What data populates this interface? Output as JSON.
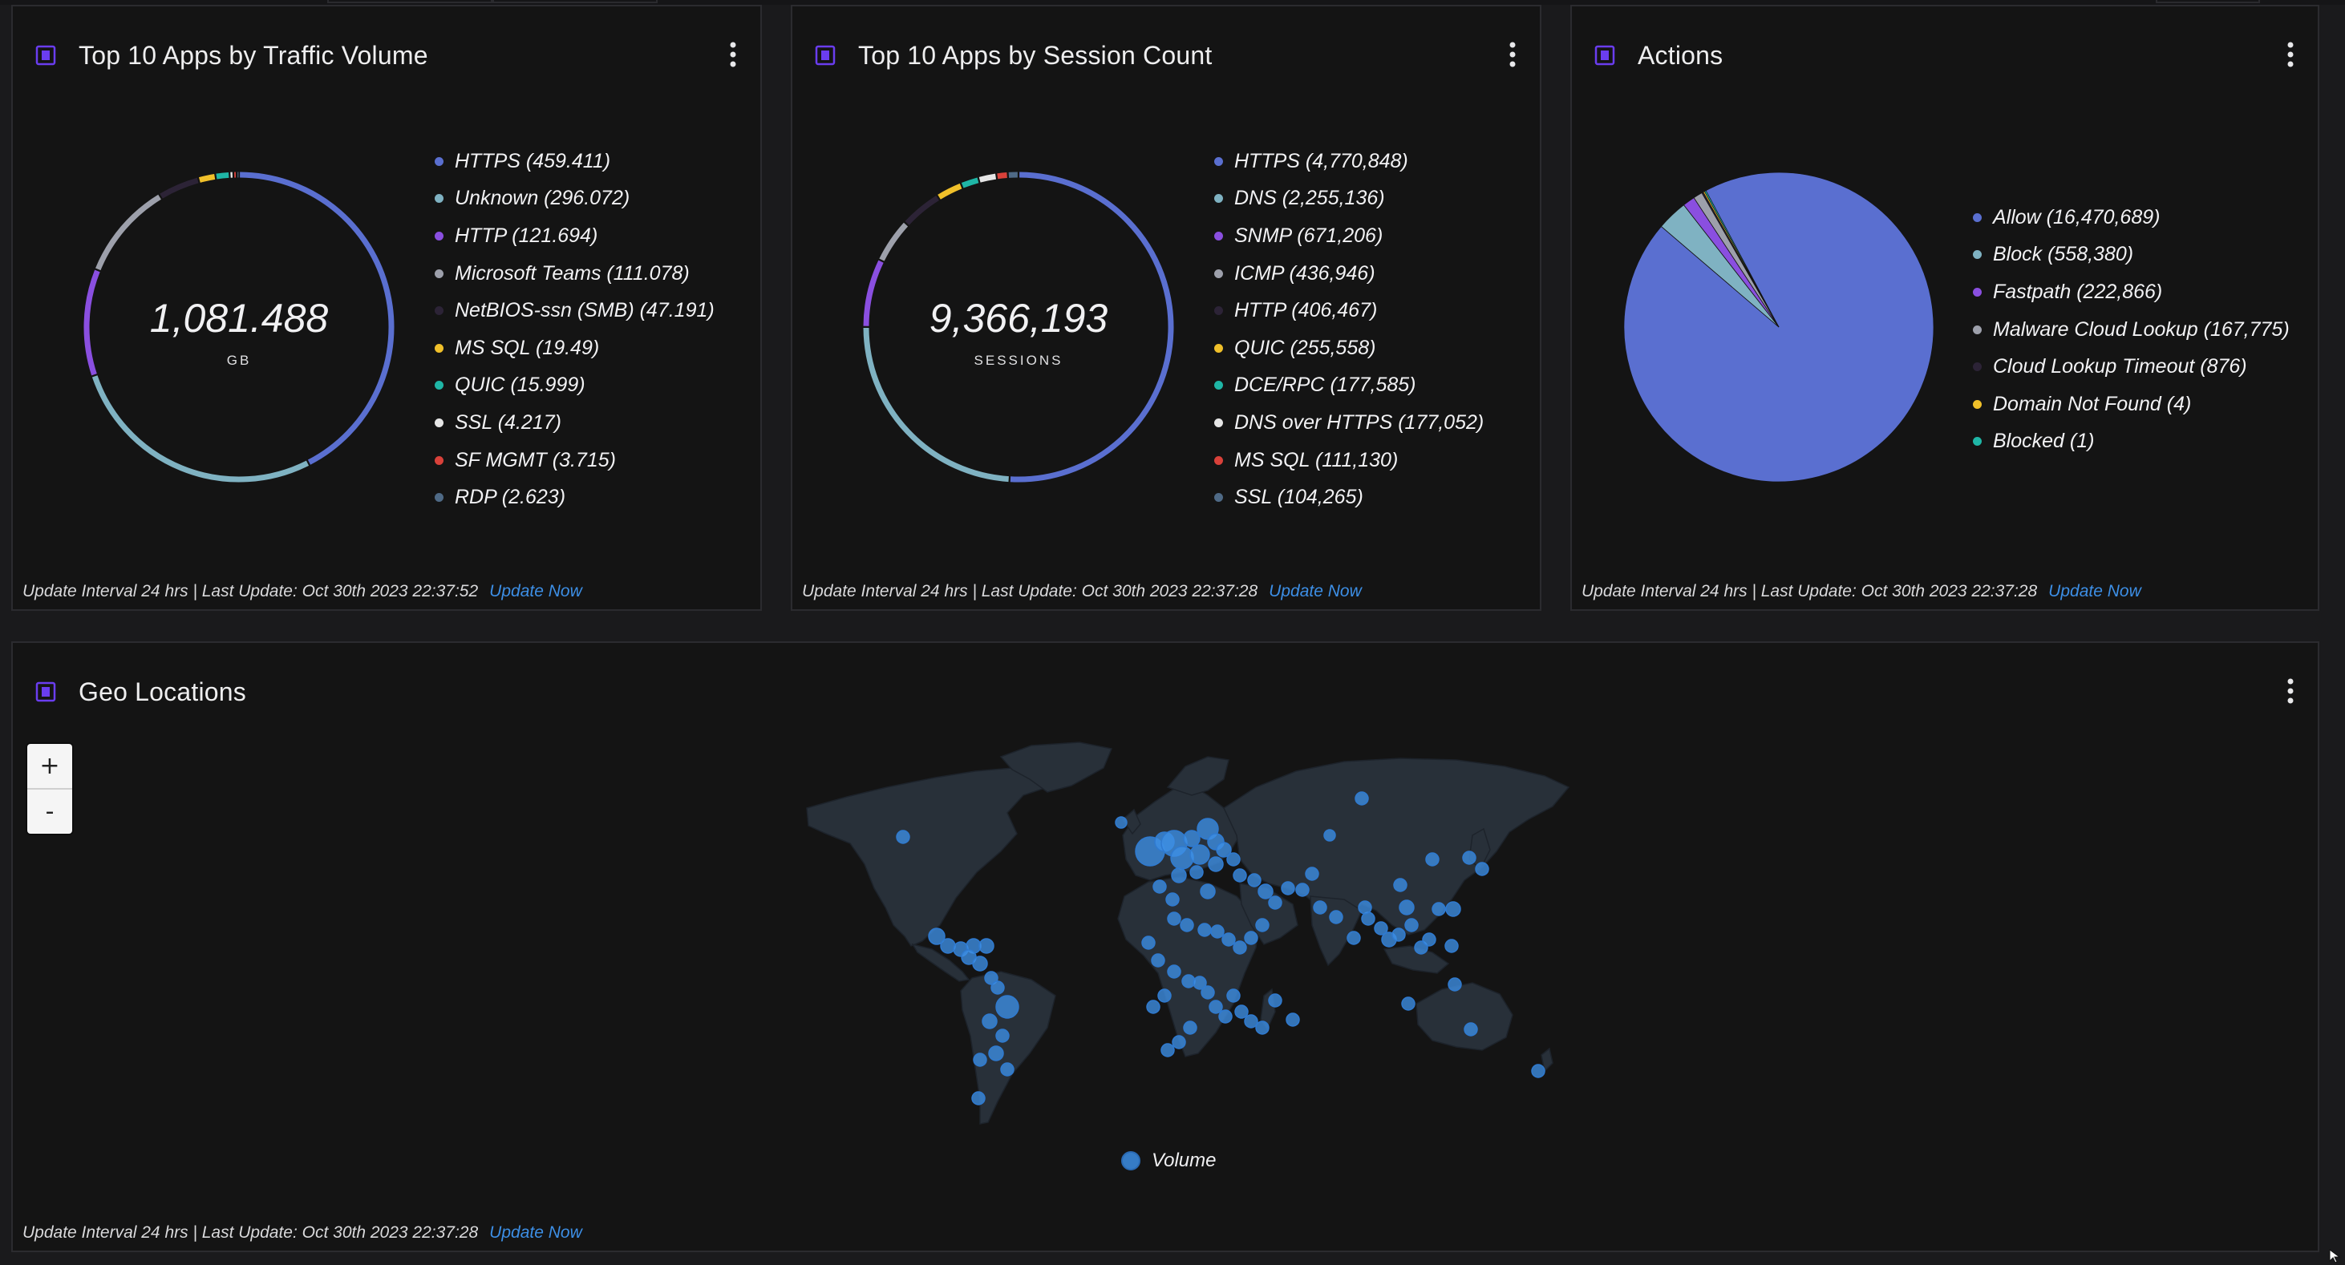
{
  "colors": {
    "accent_link": "#3d8fe6",
    "panel_bg": "#141414",
    "page_bg": "#1a1a1c",
    "map_land": "#283039",
    "map_bubble": "#3d8fe6"
  },
  "panels": {
    "traffic": {
      "title": "Top 10 Apps by Traffic Volume",
      "center_value": "1,081.488",
      "center_unit": "GB",
      "footer_text": "Update Interval 24 hrs | Last Update: Oct 30th 2023 22:37:52",
      "footer_link": "Update Now",
      "legend": [
        {
          "label": "HTTPS (459.411)",
          "color": "#5a6fd0"
        },
        {
          "label": "Unknown (296.072)",
          "color": "#7fb2c2"
        },
        {
          "label": "HTTP (121.694)",
          "color": "#8a4fe0"
        },
        {
          "label": "Microsoft Teams (111.078)",
          "color": "#9da0ab"
        },
        {
          "label": "NetBIOS-ssn (SMB) (47.191)",
          "color": "#2c2336"
        },
        {
          "label": "MS SQL (19.49)",
          "color": "#f0c02a"
        },
        {
          "label": "QUIC (15.999)",
          "color": "#1fb6a6"
        },
        {
          "label": "SSL (4.217)",
          "color": "#e6e6e6"
        },
        {
          "label": "SF MGMT (3.715)",
          "color": "#d9413a"
        },
        {
          "label": "RDP (2.623)",
          "color": "#4f6a86"
        }
      ]
    },
    "sessions": {
      "title": "Top 10 Apps by Session Count",
      "center_value": "9,366,193",
      "center_unit": "SESSIONS",
      "footer_text": "Update Interval 24 hrs | Last Update: Oct 30th 2023 22:37:28",
      "footer_link": "Update Now",
      "legend": [
        {
          "label": "HTTPS (4,770,848)",
          "color": "#5a6fd0"
        },
        {
          "label": "DNS (2,255,136)",
          "color": "#7fb2c2"
        },
        {
          "label": "SNMP (671,206)",
          "color": "#8a4fe0"
        },
        {
          "label": "ICMP (436,946)",
          "color": "#9da0ab"
        },
        {
          "label": "HTTP (406,467)",
          "color": "#2c2336"
        },
        {
          "label": "QUIC (255,558)",
          "color": "#f0c02a"
        },
        {
          "label": "DCE/RPC (177,585)",
          "color": "#1fb6a6"
        },
        {
          "label": "DNS over HTTPS (177,052)",
          "color": "#e6e6e6"
        },
        {
          "label": "MS SQL (111,130)",
          "color": "#d9413a"
        },
        {
          "label": "SSL (104,265)",
          "color": "#4f6a86"
        }
      ]
    },
    "actions": {
      "title": "Actions",
      "footer_text": "Update Interval 24 hrs | Last Update: Oct 30th 2023 22:37:28",
      "footer_link": "Update Now",
      "legend": [
        {
          "label": "Allow (16,470,689)",
          "color": "#5a6fd0"
        },
        {
          "label": "Block (558,380)",
          "color": "#7fb2c2"
        },
        {
          "label": "Fastpath (222,866)",
          "color": "#8a4fe0"
        },
        {
          "label": "Malware Cloud Lookup (167,775)",
          "color": "#9da0ab"
        },
        {
          "label": "Cloud Lookup Timeout (876)",
          "color": "#2c2336"
        },
        {
          "label": "Domain Not Found (4)",
          "color": "#f0c02a"
        },
        {
          "label": "Blocked (1)",
          "color": "#1fb6a6"
        }
      ]
    },
    "geo": {
      "title": "Geo Locations",
      "zoom_in": "+",
      "zoom_out": "-",
      "legend_label": "Volume",
      "footer_text": "Update Interval 24 hrs | Last Update: Oct 30th 2023 22:37:28",
      "footer_link": "Update Now"
    }
  },
  "chart_data": [
    {
      "type": "pie",
      "variant": "donut",
      "title": "Top 10 Apps by Traffic Volume",
      "center_value": "1,081.488",
      "unit": "GB",
      "categories": [
        "HTTPS",
        "Unknown",
        "HTTP",
        "Microsoft Teams",
        "NetBIOS-ssn (SMB)",
        "MS SQL",
        "QUIC",
        "SSL",
        "SF MGMT",
        "RDP"
      ],
      "values": [
        459.411,
        296.072,
        121.694,
        111.078,
        47.191,
        19.49,
        15.999,
        4.217,
        3.715,
        2.623
      ],
      "colors": [
        "#5a6fd0",
        "#7fb2c2",
        "#8a4fe0",
        "#9da0ab",
        "#2c2336",
        "#f0c02a",
        "#1fb6a6",
        "#e6e6e6",
        "#d9413a",
        "#4f6a86"
      ],
      "legend_position": "right"
    },
    {
      "type": "pie",
      "variant": "donut",
      "title": "Top 10 Apps by Session Count",
      "center_value": "9,366,193",
      "unit": "SESSIONS",
      "categories": [
        "HTTPS",
        "DNS",
        "SNMP",
        "ICMP",
        "HTTP",
        "QUIC",
        "DCE/RPC",
        "DNS over HTTPS",
        "MS SQL",
        "SSL"
      ],
      "values": [
        4770848,
        2255136,
        671206,
        436946,
        406467,
        255558,
        177585,
        177052,
        111130,
        104265
      ],
      "colors": [
        "#5a6fd0",
        "#7fb2c2",
        "#8a4fe0",
        "#9da0ab",
        "#2c2336",
        "#f0c02a",
        "#1fb6a6",
        "#e6e6e6",
        "#d9413a",
        "#4f6a86"
      ],
      "legend_position": "right"
    },
    {
      "type": "pie",
      "title": "Actions",
      "categories": [
        "Allow",
        "Block",
        "Fastpath",
        "Malware Cloud Lookup",
        "Cloud Lookup Timeout",
        "Domain Not Found",
        "Blocked"
      ],
      "values": [
        16470689,
        558380,
        222866,
        167775,
        876,
        4,
        1
      ],
      "colors": [
        "#5a6fd0",
        "#7fb2c2",
        "#8a4fe0",
        "#9da0ab",
        "#2c2336",
        "#f0c02a",
        "#1fb6a6"
      ],
      "legend_position": "right"
    }
  ]
}
